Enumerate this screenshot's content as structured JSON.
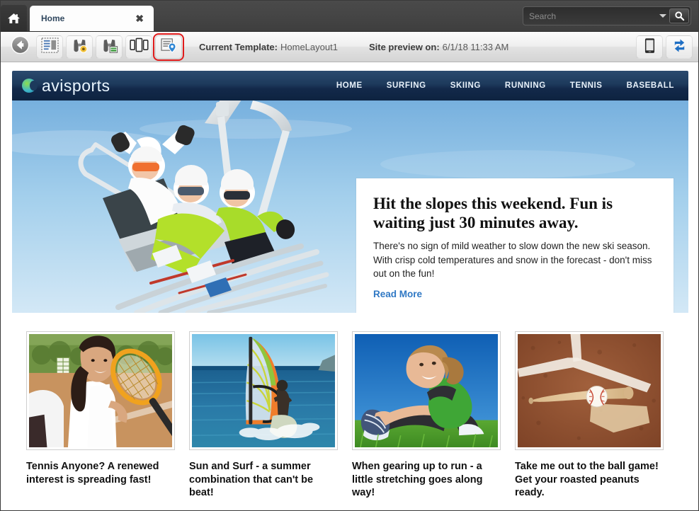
{
  "window": {
    "home_button_icon": "home-icon"
  },
  "tabs": [
    {
      "label": "Home",
      "close_label": "✖",
      "active": true
    }
  ],
  "search": {
    "placeholder": "Search",
    "value": "",
    "dropdown_icon": "chevron-down-icon",
    "button_icon": "search-icon"
  },
  "toolbar": {
    "buttons": [
      {
        "name": "back-button",
        "icon": "back-arrow-icon",
        "selected": false
      },
      {
        "name": "page-layout-button",
        "icon": "page-layout-icon",
        "selected": false
      },
      {
        "name": "preview-restricted-button",
        "icon": "binoculars-warning-icon",
        "selected": false
      },
      {
        "name": "preview-page-button",
        "icon": "binoculars-page-icon",
        "selected": false
      },
      {
        "name": "device-widths-button",
        "icon": "devices-icon",
        "selected": false
      },
      {
        "name": "location-preview-button",
        "icon": "page-location-pin-icon",
        "selected": true
      }
    ],
    "current_template_label": "Current Template:",
    "current_template_value": "HomeLayout1",
    "site_preview_label": "Site preview on:",
    "site_preview_value": "6/1/18 11:33 AM",
    "mobile_preview_icon": "mobile-device-icon",
    "refresh_icon": "refresh-sync-icon",
    "selected_outline_color": "#e01b1b"
  },
  "site": {
    "brand": "avisports",
    "brand_mark_icon": "avisports-logo-icon",
    "nav": [
      {
        "label": "HOME"
      },
      {
        "label": "SURFING"
      },
      {
        "label": "SKIING"
      },
      {
        "label": "RUNNING"
      },
      {
        "label": "TENNIS"
      },
      {
        "label": "BASEBALL"
      }
    ],
    "header_bg": "#13294a",
    "hero": {
      "image_alt": "three-skiers-on-chairlift-photo",
      "title": "Hit the slopes this weekend. Fun is waiting just 30 minutes away.",
      "body": "There's no sign of mild weather to slow down the new ski season.  With crisp cold temperatures and snow in the forecast - don't miss out on the fun!",
      "link_label": "Read More",
      "link_color": "#2f78c4"
    },
    "cards": [
      {
        "image_alt": "woman-with-tennis-racket-photo",
        "title": "Tennis Anyone? A renewed interest is spreading fast!"
      },
      {
        "image_alt": "windsurfer-on-ocean-photo",
        "title": "Sun and Surf - a summer combination that can't be beat!"
      },
      {
        "image_alt": "woman-stretching-on-grass-photo",
        "title": "When gearing up to run - a little stretching goes along way!"
      },
      {
        "image_alt": "baseball-bat-and-ball-on-home-plate-photo",
        "title": "Take me out to the ball game! Get your roasted peanuts ready."
      }
    ]
  }
}
